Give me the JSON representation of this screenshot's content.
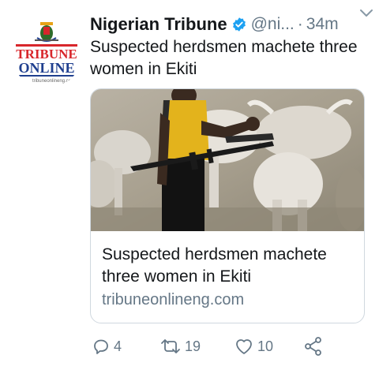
{
  "tweet": {
    "display_name": "Nigerian Tribune",
    "handle": "@ni...",
    "separator": "·",
    "time": "34m",
    "text": "Suspected herdsmen machete three women in Ekiti"
  },
  "avatar": {
    "logo_line1": "TRIBUNE",
    "logo_line2": "ONLINE",
    "logo_sub": "tribuneonlineng.com",
    "colors": {
      "red": "#d8262b",
      "blue": "#1f3f8f"
    }
  },
  "card": {
    "title": "Suspected herdsmen machete three women in Ekiti",
    "domain": "tribuneonlineng.com"
  },
  "actions": {
    "reply_count": "4",
    "retweet_count": "19",
    "like_count": "10"
  },
  "icons": {
    "verified": "verified-badge-icon",
    "caret": "chevron-down-icon",
    "reply": "reply-icon",
    "retweet": "retweet-icon",
    "like": "heart-icon",
    "share": "share-icon"
  },
  "colors": {
    "text": "#14171a",
    "secondary": "#657786",
    "verified": "#1da1f2",
    "border": "#d0d8df"
  }
}
